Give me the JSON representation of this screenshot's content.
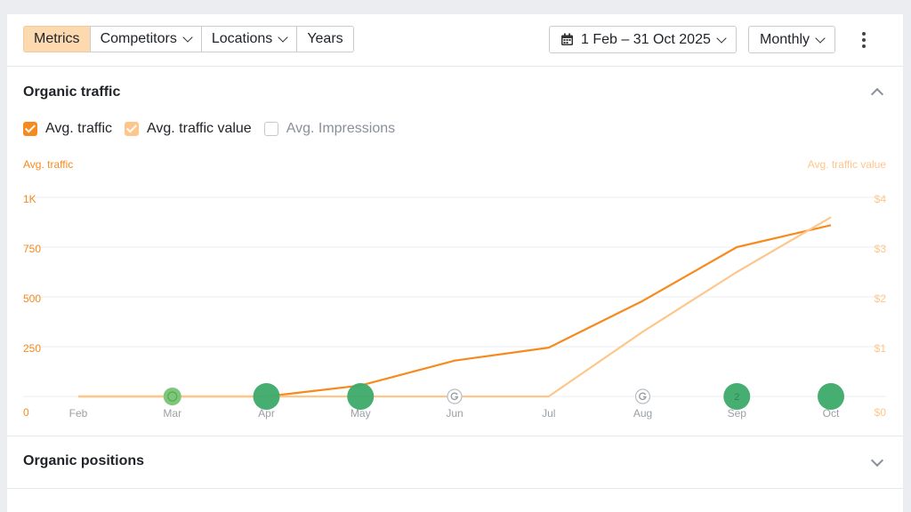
{
  "toolbar": {
    "tabs": [
      {
        "label": "Metrics",
        "active": true
      },
      {
        "label": "Competitors",
        "dropdown": true
      },
      {
        "label": "Locations",
        "dropdown": true
      },
      {
        "label": "Years"
      }
    ],
    "date_range": "1 Feb – 31 Oct 2025",
    "granularity": "Monthly"
  },
  "sections": {
    "organic_traffic": "Organic traffic",
    "organic_positions": "Organic positions"
  },
  "legend": {
    "items": [
      {
        "label": "Avg. traffic",
        "checked": true,
        "color": "#f68a1e"
      },
      {
        "label": "Avg. traffic value",
        "checked": true,
        "color": "#ffc68c"
      },
      {
        "label": "Avg. Impressions",
        "checked": false,
        "color": "#8a9099"
      }
    ]
  },
  "chart_data": {
    "type": "line",
    "categories": [
      "Feb",
      "Mar",
      "Apr",
      "May",
      "Jun",
      "Jul",
      "Aug",
      "Sep",
      "Oct"
    ],
    "left_axis": {
      "title": "Avg. traffic",
      "ticks": [
        "0",
        "250",
        "500",
        "750",
        "1K"
      ],
      "range": [
        0,
        1000
      ]
    },
    "right_axis": {
      "title": "Avg. traffic value",
      "ticks": [
        "$0",
        "$1",
        "$2",
        "$3",
        "$4"
      ],
      "range": [
        0,
        4
      ]
    },
    "grid": true,
    "series": [
      {
        "name": "Avg. traffic",
        "axis": "left",
        "color": "#f68a1e",
        "values": [
          0,
          0,
          0,
          55,
          180,
          245,
          480,
          750,
          860
        ]
      },
      {
        "name": "Avg. traffic value",
        "axis": "right",
        "color": "#ffc68c",
        "values": [
          0,
          0,
          0,
          0,
          0,
          0,
          1.3,
          2.5,
          3.6
        ]
      }
    ],
    "annotations": [
      {
        "month": "Mar",
        "kind": "google-update",
        "color": "#7dc77a"
      },
      {
        "month": "Apr",
        "kind": "event",
        "color": "#3daa6a"
      },
      {
        "month": "May",
        "kind": "event",
        "color": "#3daa6a"
      },
      {
        "month": "Jun",
        "kind": "google-update-outline"
      },
      {
        "month": "Aug",
        "kind": "google-update-outline"
      },
      {
        "month": "Sep",
        "kind": "event",
        "count": "2",
        "color": "#3daa6a"
      },
      {
        "month": "Oct",
        "kind": "event",
        "color": "#3daa6a"
      }
    ]
  },
  "icons": {
    "calendar": "calendar-icon",
    "more": "more-vertical-icon",
    "google": "google-g-icon"
  }
}
